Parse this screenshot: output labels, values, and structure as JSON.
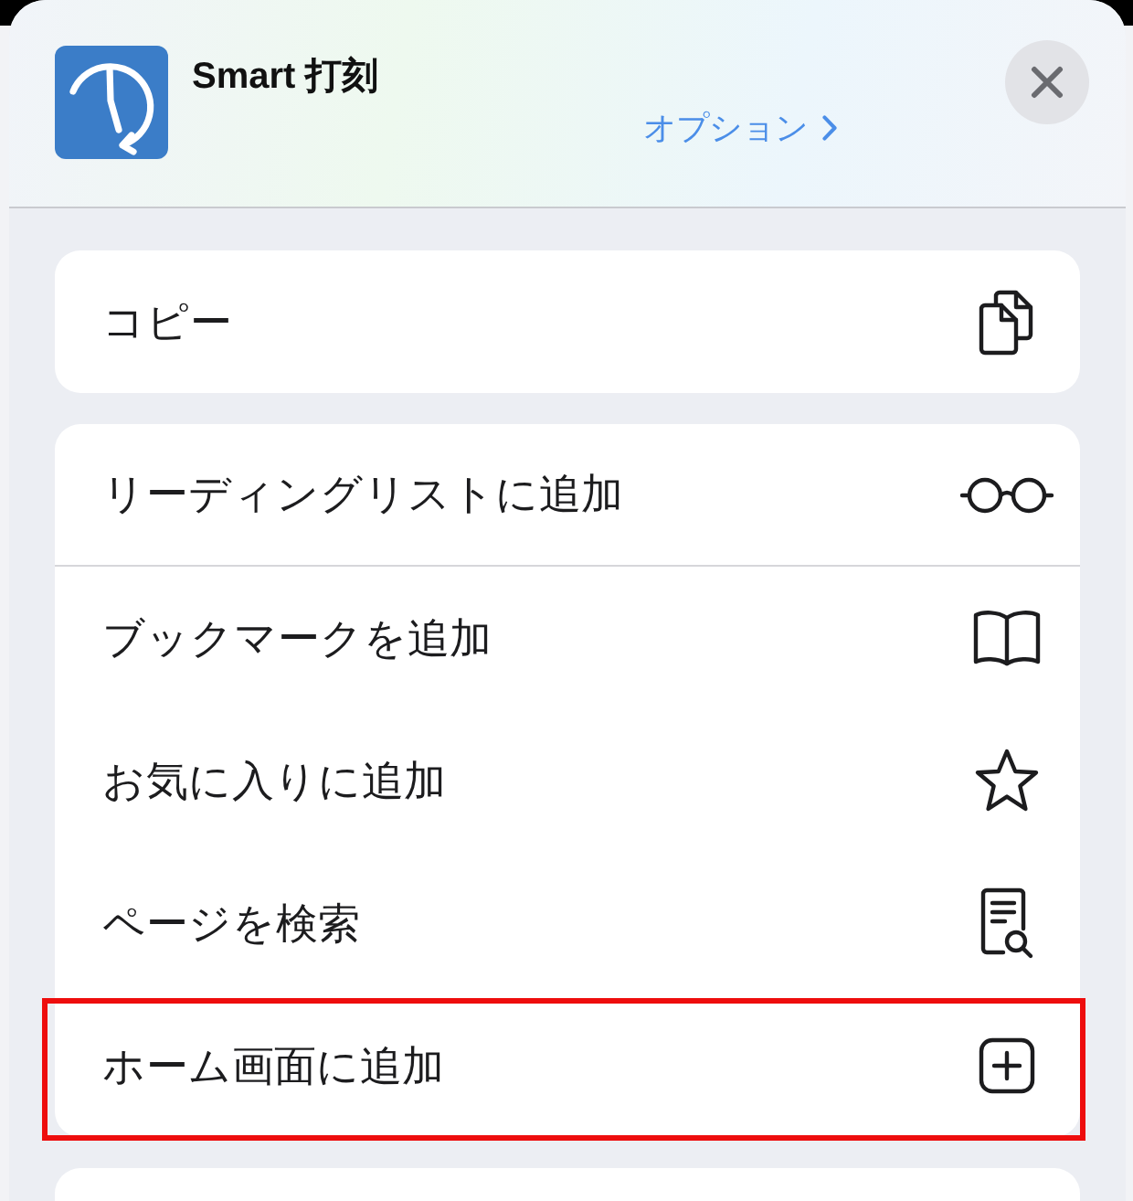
{
  "header": {
    "app_name": "Smart 打刻",
    "options_link": "オプション"
  },
  "groups": [
    {
      "items": [
        {
          "label": "コピー",
          "kind": "copy",
          "separator": false,
          "highlighted": false
        }
      ]
    },
    {
      "items": [
        {
          "label": "リーディングリストに追加",
          "kind": "reading-list",
          "separator": true,
          "highlighted": false
        },
        {
          "label": "ブックマークを追加",
          "kind": "bookmark",
          "separator": false,
          "highlighted": false
        },
        {
          "label": "お気に入りに追加",
          "kind": "favorite",
          "separator": false,
          "highlighted": false
        },
        {
          "label": "ページを検索",
          "kind": "find",
          "separator": false,
          "highlighted": false
        },
        {
          "label": "ホーム画面に追加",
          "kind": "add-home",
          "separator": false,
          "highlighted": true
        }
      ]
    }
  ],
  "trailing_card": true
}
